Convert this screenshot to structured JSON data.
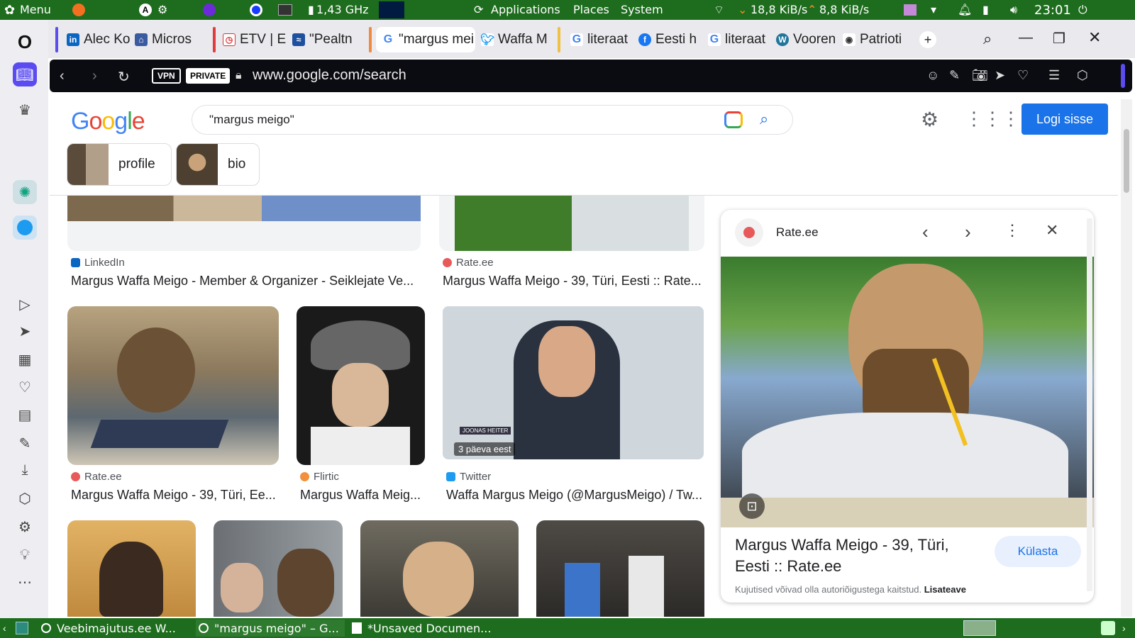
{
  "system_panel": {
    "menu_label": "Menu",
    "cpu_freq": "1,43 GHz",
    "menus": [
      "Applications",
      "Places",
      "System"
    ],
    "net_down": "18,8 KiB/s",
    "net_up": "8,8 KiB/s",
    "clock": "23:01"
  },
  "tabs": [
    {
      "label": "Alec Ko",
      "icon": "linkedin-icon"
    },
    {
      "label": "Micros",
      "icon": "building-icon"
    },
    {
      "label": "ETV | E",
      "icon": "etv-icon"
    },
    {
      "label": "\"Pealtn",
      "icon": "err-icon"
    },
    {
      "label": "\"margus mei",
      "icon": "google-icon"
    },
    {
      "label": "Waffa M",
      "icon": "twitter-icon"
    },
    {
      "label": "literaat",
      "icon": "google-icon"
    },
    {
      "label": "Eesti h",
      "icon": "facebook-icon"
    },
    {
      "label": "literaat",
      "icon": "google-icon"
    },
    {
      "label": "Vooren",
      "icon": "wordpress-icon"
    },
    {
      "label": "Patrioti",
      "icon": "podcast-icon"
    }
  ],
  "address_bar": {
    "vpn_label": "VPN",
    "private_label": "PRIVATE",
    "url": "www.google.com/search"
  },
  "google": {
    "logo": "Google",
    "query": "\"margus meigo\"",
    "login_label": "Logi sisse",
    "chips": [
      {
        "label": "profile"
      },
      {
        "label": "bio"
      }
    ]
  },
  "results": [
    {
      "source": "LinkedIn",
      "title": "Margus Waffa Meigo - Member & Organizer - Seiklejate Ve..."
    },
    {
      "source": "Rate.ee",
      "title": "Margus Waffa Meigo - 39, Türi, Eesti :: Rate..."
    },
    {
      "source": "Rate.ee",
      "title": "Margus Waffa Meigo - 39, Türi, Ee..."
    },
    {
      "source": "Flirtic",
      "title": "Margus Waffa Meig..."
    },
    {
      "source": "Twitter",
      "title": "Waffa Margus Meigo (@MargusMeigo) / Tw...",
      "overlay": "3 päeva eest",
      "caption": "JOONAS HEITER"
    }
  ],
  "side_panel": {
    "source": "Rate.ee",
    "title": "Margus Waffa Meigo - 39, Türi, Eesti :: Rate.ee",
    "visit_label": "Külasta",
    "notice": "Kujutised võivad olla autoriõigustega kaitstud.",
    "more_label": "Lisateave"
  },
  "taskbar": {
    "tasks": [
      "Veebimajutus.ee W...",
      "\"margus meigo\" – G...",
      "*Unsaved Documen..."
    ]
  },
  "colors": {
    "system_green": "#1e6d1e",
    "google_blue": "#1a73e8",
    "opera_red": "#ff1b2d",
    "sidebar_accent": "#5a4cf0"
  }
}
